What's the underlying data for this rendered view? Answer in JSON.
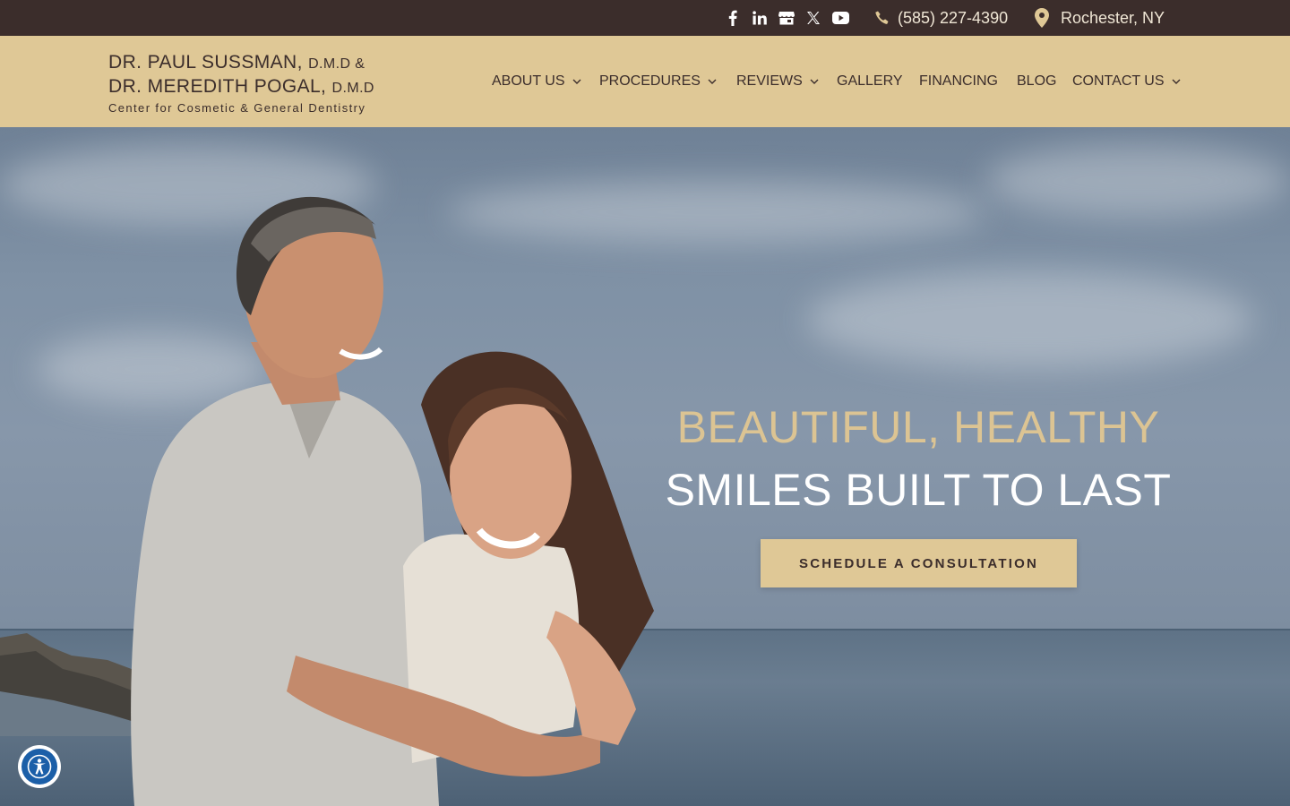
{
  "topbar": {
    "social": [
      {
        "icon": "facebook-icon"
      },
      {
        "icon": "linkedin-icon"
      },
      {
        "icon": "google-business-icon"
      },
      {
        "icon": "x-twitter-icon"
      },
      {
        "icon": "youtube-icon"
      }
    ],
    "phone": "(585) 227-4390",
    "location": "Rochester, NY"
  },
  "logo": {
    "line1_name": "DR. PAUL SUSSMAN,",
    "line1_suffix": "D.M.D &",
    "line2_name": "DR. MEREDITH POGAL,",
    "line2_suffix": "D.M.D",
    "tagline": "Center for Cosmetic & General Dentistry"
  },
  "nav": {
    "items": [
      {
        "label": "ABOUT US",
        "dropdown": true
      },
      {
        "label": "PROCEDURES",
        "dropdown": true
      },
      {
        "label": "REVIEWS",
        "dropdown": true
      },
      {
        "label": "GALLERY",
        "dropdown": false
      },
      {
        "label": "FINANCING",
        "dropdown": false
      },
      {
        "label": "BLOG",
        "dropdown": false
      },
      {
        "label": "CONTACT US",
        "dropdown": true
      }
    ]
  },
  "hero": {
    "headline_line1": "BEAUTIFUL, HEALTHY",
    "headline_line2": "SMILES BUILT TO LAST",
    "cta_label": "SCHEDULE A CONSULTATION",
    "image": "couple-on-beach-photo"
  },
  "accessibility": {
    "icon": "accessibility-icon"
  },
  "colors": {
    "topbar": "#3b2d2b",
    "header_bg": "#dfc896",
    "accent_gold": "#dcc493",
    "text_dark": "#3b2d2b"
  }
}
